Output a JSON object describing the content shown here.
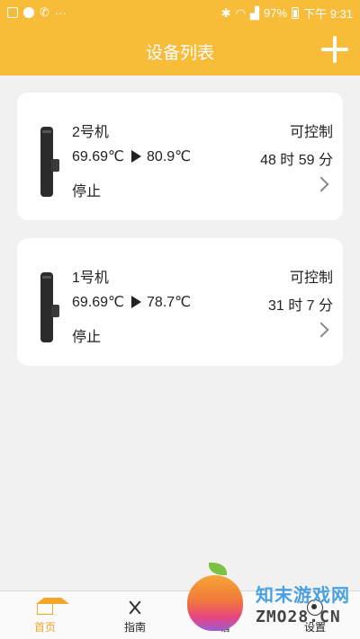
{
  "status_bar": {
    "battery": "97%",
    "time": "下午 9:31"
  },
  "header": {
    "title": "设备列表"
  },
  "devices": [
    {
      "name": "2号机",
      "current_temp": "69.69℃",
      "target_temp": "80.9℃",
      "control": "可控制",
      "remaining": "48 时 59 分",
      "state": "停止"
    },
    {
      "name": "1号机",
      "current_temp": "69.69℃",
      "target_temp": "78.7℃",
      "control": "可控制",
      "remaining": "31 时 7 分",
      "state": "停止"
    }
  ],
  "tabs": [
    {
      "label": "首页",
      "icon": "home-icon",
      "active": true
    },
    {
      "label": "指南",
      "icon": "utensils-icon",
      "active": false
    },
    {
      "label": "谱",
      "icon": "recipe-icon",
      "active": false
    },
    {
      "label": "设置",
      "icon": "settings-icon",
      "active": false
    }
  ],
  "watermark": {
    "name": "知末游戏网",
    "url": "ZMO28.CN"
  },
  "colors": {
    "accent": "#f7bc3a",
    "active_tab": "#f0a72a"
  }
}
